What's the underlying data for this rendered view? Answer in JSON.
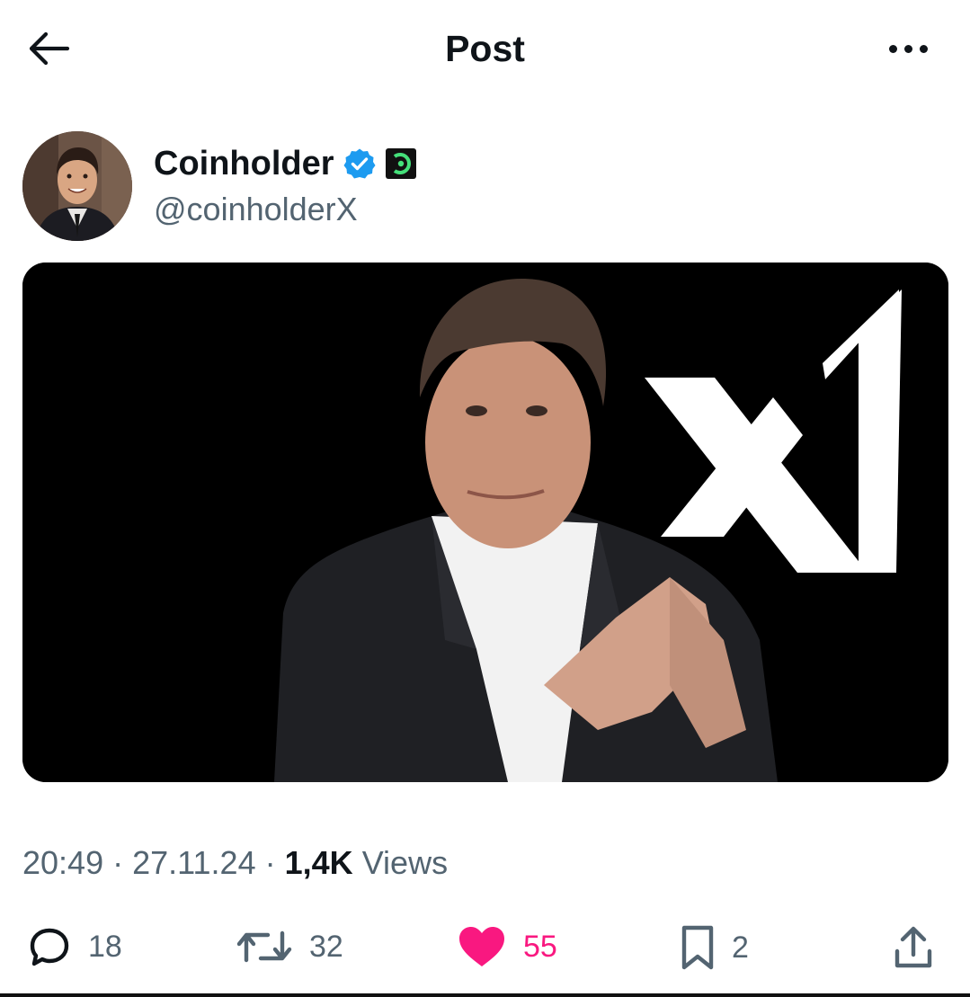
{
  "header": {
    "title": "Post"
  },
  "author": {
    "display_name": "Coinholder",
    "handle": "@coinholderX"
  },
  "post": {
    "time": "20:49",
    "separator": "·",
    "date": "27.11.24",
    "views_count": "1,4K",
    "views_label": "Views"
  },
  "actions": {
    "replies": "18",
    "reposts": "32",
    "likes": "55",
    "bookmarks": "2"
  },
  "colors": {
    "like": "#f91880",
    "verified": "#1d9bf0",
    "secondary_text": "#536471"
  },
  "icons": [
    "back-arrow-icon",
    "more-options-icon",
    "verified-badge-icon",
    "affiliate-badge-icon",
    "reply-icon",
    "repost-icon",
    "like-icon",
    "bookmark-icon",
    "share-icon"
  ]
}
